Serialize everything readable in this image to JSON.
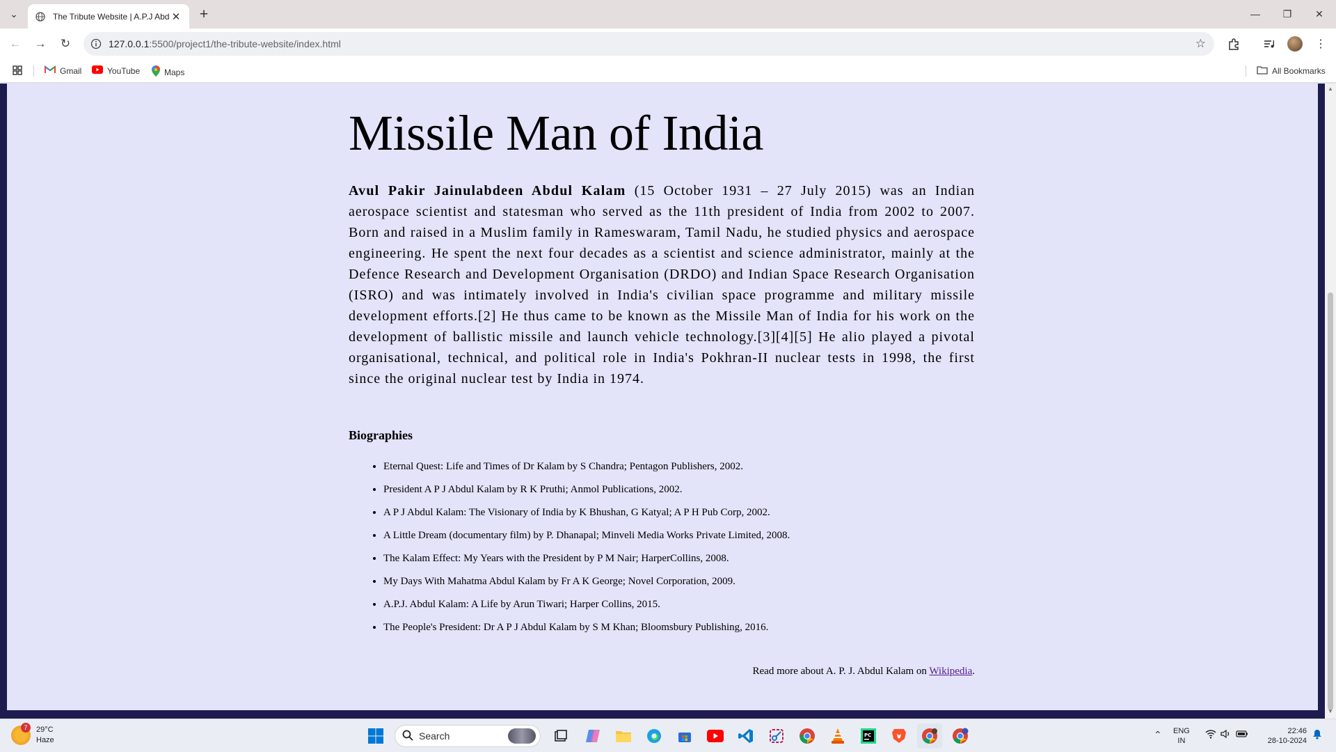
{
  "browser": {
    "tab_title": "The Tribute Website | A.P.J Abd",
    "url_host": "127.0.0.1",
    "url_rest": ":5500/project1/the-tribute-website/index.html",
    "bookmarks": [
      {
        "label": "Gmail",
        "icon": "gmail-icon"
      },
      {
        "label": "YouTube",
        "icon": "youtube-icon"
      },
      {
        "label": "Maps",
        "icon": "maps-icon"
      }
    ],
    "all_bookmarks": "All Bookmarks"
  },
  "page": {
    "title": "Missile Man of India",
    "bio_name": "Avul Pakir Jainulabdeen Abdul Kalam",
    "bio_text": " (15 October 1931 – 27 July 2015) was an Indian aerospace scientist and statesman who served as the 11th president of India from 2002 to 2007. Born and raised in a Muslim family in Rameswaram, Tamil Nadu, he studied physics and aerospace engineering. He spent the next four decades as a scientist and science administrator, mainly at the Defence Research and Development Organisation (DRDO) and Indian Space Research Organisation (ISRO) and was intimately involved in India's civilian space programme and military missile development efforts.[2] He thus came to be known as the Missile Man of India for his work on the development of ballistic missile and launch vehicle technology.[3][4][5] He alio played a pivotal organisational, technical, and political role in India's Pokhran-II nuclear tests in 1998, the first since the original nuclear test by India in 1974.",
    "biographies_heading": "Biographies",
    "biographies": [
      "Eternal Quest: Life and Times of Dr Kalam by S Chandra; Pentagon Publishers, 2002.",
      "President A P J Abdul Kalam by R K Pruthi; Anmol Publications, 2002.",
      "A P J Abdul Kalam: The Visionary of India by K Bhushan, G Katyal; A P H Pub Corp, 2002.",
      "A Little Dream (documentary film) by P. Dhanapal; Minveli Media Works Private Limited, 2008.",
      "The Kalam Effect: My Years with the President by P M Nair; HarperCollins, 2008.",
      "My Days With Mahatma Abdul Kalam by Fr A K George; Novel Corporation, 2009.",
      "A.P.J. Abdul Kalam: A Life by Arun Tiwari; Harper Collins, 2015.",
      "The People's President: Dr A P J Abdul Kalam by S M Khan; Bloomsbury Publishing, 2016."
    ],
    "read_more_prefix": "Read more about A. P. J. Abdul Kalam on ",
    "read_more_link": "Wikipedia",
    "read_more_suffix": "."
  },
  "taskbar": {
    "weather_badge": "7",
    "temperature": "29°C",
    "condition": "Haze",
    "search_label": "Search",
    "lang_top": "ENG",
    "lang_bottom": "IN",
    "time": "22:46",
    "date": "28-10-2024"
  },
  "colors": {
    "page_bg": "#e3e3fa",
    "frame_bg": "#1e1b4e",
    "link_visited": "#551a8b"
  }
}
